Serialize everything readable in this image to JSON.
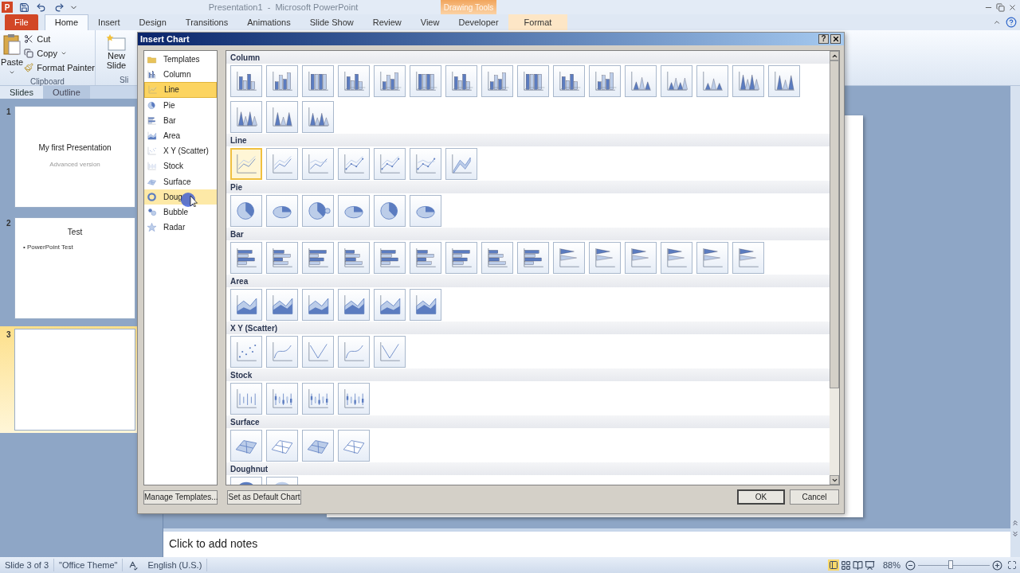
{
  "app": {
    "logo": "P",
    "title": "Presentation1  -  Microsoft PowerPoint",
    "contextual_tab": "Drawing Tools"
  },
  "ribbon_tabs": [
    {
      "label": "File",
      "kind": "file",
      "selected": false
    },
    {
      "label": "Home",
      "kind": "normal",
      "selected": true
    },
    {
      "label": "Insert",
      "kind": "normal",
      "selected": false
    },
    {
      "label": "Design",
      "kind": "normal",
      "selected": false
    },
    {
      "label": "Transitions",
      "kind": "normal",
      "selected": false
    },
    {
      "label": "Animations",
      "kind": "normal",
      "selected": false
    },
    {
      "label": "Slide Show",
      "kind": "normal",
      "selected": false
    },
    {
      "label": "Review",
      "kind": "normal",
      "selected": false
    },
    {
      "label": "View",
      "kind": "normal",
      "selected": false
    },
    {
      "label": "Developer",
      "kind": "normal",
      "selected": false
    },
    {
      "label": "Format",
      "kind": "contextual",
      "selected": false
    }
  ],
  "clipboard": {
    "paste": "Paste",
    "cut": "Cut",
    "copy": "Copy",
    "format_painter": "Format Painter",
    "group": "Clipboard"
  },
  "slides_group": {
    "new_slide": "New Slide",
    "group": "Sli"
  },
  "pane_tabs": [
    {
      "label": "Slides",
      "selected": true
    },
    {
      "label": "Outline",
      "selected": false
    }
  ],
  "slides": [
    {
      "number": "1",
      "title": "My first Presentation",
      "subtitle": "Advanced version",
      "selected": false
    },
    {
      "number": "2",
      "title": "Test",
      "bullets": [
        "• PowerPoint Test"
      ],
      "selected": false
    },
    {
      "number": "3",
      "selected": true
    }
  ],
  "notes": {
    "placeholder": "Click to add notes"
  },
  "dialog": {
    "title": "Insert Chart",
    "help": "?"
  },
  "chart_types": [
    {
      "label": "Templates",
      "kind": "templates",
      "selected": false,
      "hovered": false
    },
    {
      "label": "Column",
      "kind": "column",
      "selected": false,
      "hovered": false
    },
    {
      "label": "Line",
      "kind": "line",
      "selected": true,
      "hovered": false
    },
    {
      "label": "Pie",
      "kind": "pie",
      "selected": false,
      "hovered": false
    },
    {
      "label": "Bar",
      "kind": "bar",
      "selected": false,
      "hovered": false
    },
    {
      "label": "Area",
      "kind": "area",
      "selected": false,
      "hovered": false
    },
    {
      "label": "X Y (Scatter)",
      "kind": "scatter",
      "selected": false,
      "hovered": false
    },
    {
      "label": "Stock",
      "kind": "stock",
      "selected": false,
      "hovered": false
    },
    {
      "label": "Surface",
      "kind": "surface",
      "selected": false,
      "hovered": false
    },
    {
      "label": "Doug",
      "kind": "doughnut",
      "selected": false,
      "hovered": true
    },
    {
      "label": "Bubble",
      "kind": "bubble",
      "selected": false,
      "hovered": false
    },
    {
      "label": "Radar",
      "kind": "radar",
      "selected": false,
      "hovered": false
    }
  ],
  "gallery": [
    {
      "title": "Column",
      "kind": "column",
      "items": [
        {
          "selected": false
        },
        {
          "selected": false
        },
        {
          "selected": false
        },
        {
          "selected": false
        },
        {
          "selected": false
        },
        {
          "selected": false
        },
        {
          "selected": false
        },
        {
          "selected": false
        },
        {
          "selected": false
        },
        {
          "selected": false
        },
        {
          "selected": false
        },
        {
          "selected": false
        },
        {
          "selected": false
        },
        {
          "selected": false
        },
        {
          "selected": false
        },
        {
          "selected": false
        },
        {
          "selected": false
        },
        {
          "selected": false
        },
        {
          "selected": false
        }
      ]
    },
    {
      "title": "Line",
      "kind": "line",
      "items": [
        {
          "selected": true
        },
        {
          "selected": false
        },
        {
          "selected": false
        },
        {
          "selected": false
        },
        {
          "selected": false
        },
        {
          "selected": false
        },
        {
          "selected": false
        }
      ]
    },
    {
      "title": "Pie",
      "kind": "pie",
      "items": [
        {
          "selected": false
        },
        {
          "selected": false
        },
        {
          "selected": false
        },
        {
          "selected": false
        },
        {
          "selected": false
        },
        {
          "selected": false
        }
      ]
    },
    {
      "title": "Bar",
      "kind": "bar",
      "items": [
        {
          "selected": false
        },
        {
          "selected": false
        },
        {
          "selected": false
        },
        {
          "selected": false
        },
        {
          "selected": false
        },
        {
          "selected": false
        },
        {
          "selected": false
        },
        {
          "selected": false
        },
        {
          "selected": false
        },
        {
          "selected": false
        },
        {
          "selected": false
        },
        {
          "selected": false
        },
        {
          "selected": false
        },
        {
          "selected": false
        },
        {
          "selected": false
        }
      ]
    },
    {
      "title": "Area",
      "kind": "area",
      "items": [
        {
          "selected": false
        },
        {
          "selected": false
        },
        {
          "selected": false
        },
        {
          "selected": false
        },
        {
          "selected": false
        },
        {
          "selected": false
        }
      ]
    },
    {
      "title": "X Y (Scatter)",
      "kind": "scatter",
      "items": [
        {
          "selected": false
        },
        {
          "selected": false
        },
        {
          "selected": false
        },
        {
          "selected": false
        },
        {
          "selected": false
        }
      ]
    },
    {
      "title": "Stock",
      "kind": "stock",
      "items": [
        {
          "selected": false
        },
        {
          "selected": false
        },
        {
          "selected": false
        },
        {
          "selected": false
        }
      ]
    },
    {
      "title": "Surface",
      "kind": "surface",
      "items": [
        {
          "selected": false
        },
        {
          "selected": false
        },
        {
          "selected": false
        },
        {
          "selected": false
        }
      ]
    },
    {
      "title": "Doughnut",
      "kind": "doughnut",
      "items": [
        {
          "selected": false
        },
        {
          "selected": false
        }
      ]
    }
  ],
  "buttons": {
    "manage": "Manage Templates...",
    "set_default": "Set as Default Chart",
    "ok": "OK",
    "cancel": "Cancel"
  },
  "status": {
    "slide": "Slide 3 of 3",
    "theme": "\"Office Theme\"",
    "language": "English (U.S.)",
    "zoom": "88%",
    "zoom_slider": {
      "level": 0.45
    }
  }
}
